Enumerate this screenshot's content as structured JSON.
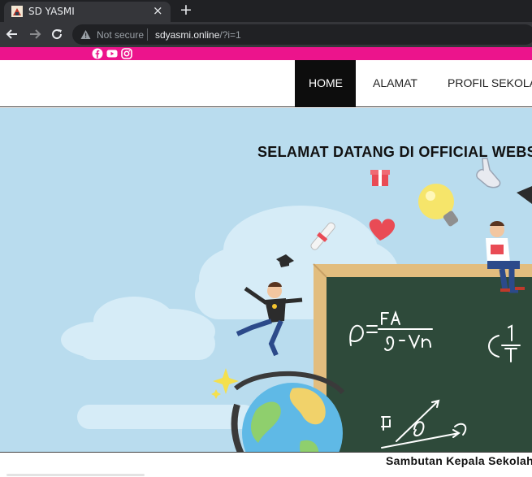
{
  "browser": {
    "tab_title": "SD YASMI",
    "tab_close": "×",
    "new_tab": "+",
    "security_label": "Not secure",
    "url_domain": "sdyasmi.online",
    "url_path": "/?i=1"
  },
  "social": {
    "icons": [
      "facebook-icon",
      "youtube-icon",
      "instagram-icon"
    ],
    "bar_color": "#ec148c"
  },
  "nav": {
    "items": [
      {
        "label": "HOME",
        "active": true
      },
      {
        "label": "ALAMAT",
        "active": false
      },
      {
        "label": "PROFIL SEKOLAH",
        "active": false
      }
    ]
  },
  "hero": {
    "title": "SELAMAT DATANG DI OFFICIAL WEBSITE",
    "board_formula": "ρ = Fa / g·Vn"
  },
  "section": {
    "heading": "Sambutan Kepala Sekolah"
  },
  "colors": {
    "accent": "#ec148c",
    "nav_active_bg": "#0d0d0d",
    "hero_bg": "#b9dcee",
    "chalkboard": "#2e4a3a",
    "board_frame": "#e2bd7e"
  }
}
